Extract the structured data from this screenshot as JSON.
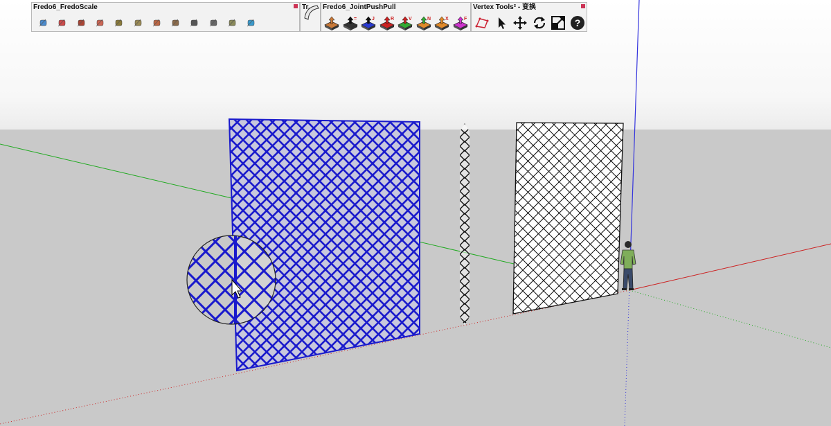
{
  "toolbars": {
    "fredoscale": {
      "title": "Fredo6_FredoScale",
      "icons": [
        "scale-icon",
        "box-stretch-icon",
        "tapering-icon",
        "planar-shear-icon",
        "stretch-icon",
        "twist-icon",
        "bend-icon",
        "bend-alt-icon",
        "rotate-icon",
        "radial-bend-icon",
        "unbend-icon",
        "about-icon"
      ]
    },
    "tr": {
      "title": "Tr..."
    },
    "jointpushpull": {
      "title": "Fredo6_JointPushPull",
      "letters": [
        "",
        "=",
        "J",
        "R",
        "V",
        "N",
        "X",
        "F"
      ],
      "icons": [
        "joint-push-pull-icon",
        "vector-push-pull-icon",
        "joint-push-pull-j-icon",
        "round-push-pull-icon",
        "vector-v-push-pull-icon",
        "normal-push-pull-icon",
        "extrude-x-icon",
        "follow-icon"
      ]
    },
    "vertex_tools": {
      "title": "Vertex Tools² - 变换",
      "icons": [
        "vertex-select-icon",
        "cursor-icon",
        "move-icon",
        "rotate-icon",
        "scale-icon",
        "help-icon"
      ]
    }
  },
  "colors": {
    "sky": "#ffffff",
    "ground": "#c9c9c9",
    "selection_blue": "#1a1acc",
    "axis_red": "#cc2222",
    "axis_green": "#22aa22",
    "axis_blue": "#3333dd"
  }
}
